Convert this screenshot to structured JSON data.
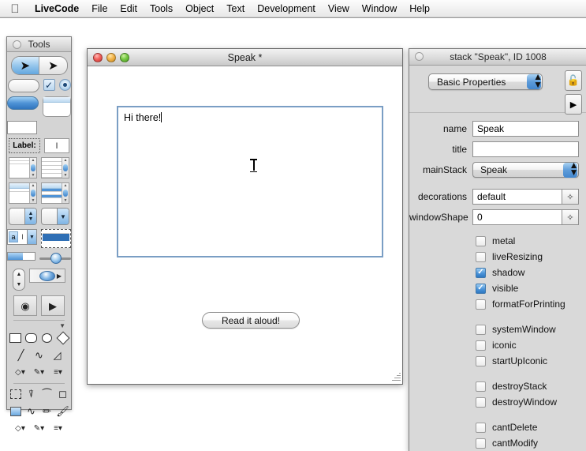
{
  "menubar": {
    "apple_icon": "apple-logo",
    "items": [
      {
        "label": "LiveCode",
        "bold": true
      },
      {
        "label": "File"
      },
      {
        "label": "Edit"
      },
      {
        "label": "Tools"
      },
      {
        "label": "Object"
      },
      {
        "label": "Text"
      },
      {
        "label": "Development"
      },
      {
        "label": "View"
      },
      {
        "label": "Window"
      },
      {
        "label": "Help"
      }
    ]
  },
  "tools_palette": {
    "title": "Tools",
    "selected_tool": "browse-tool",
    "tools": [
      "browse-tool",
      "pointer-tool",
      "button-tool",
      "checkbox-tool",
      "radiobutton-tool",
      "default-button-tool",
      "tabbed-button-tool",
      "rectangle-button-tool",
      "opaque-button-tool",
      "label-field-tool",
      "text-field-tool",
      "scrolling-field-tool",
      "table-field-tool",
      "list-field-tool",
      "scrolling-list-tool",
      "stepper-tool",
      "option-menu-tool",
      "combobox-tool",
      "datagrid-tool",
      "progressbar-tool",
      "slider-tool",
      "spinner-tool",
      "player-tool",
      "graphic-tool",
      "video-player-tool"
    ],
    "vector_tools": [
      "rectangle-tool",
      "rounded-rectangle-tool",
      "oval-tool",
      "polygon-tool",
      "line-tool",
      "curve-tool",
      "freehand-polygon-tool"
    ],
    "vector_options": [
      "fill-color-tool",
      "pen-color-tool",
      "line-size-tool"
    ],
    "paint_tools": [
      "select-tool",
      "bucket-tool",
      "spray-tool",
      "eraser-tool",
      "rectangle-paint-tool",
      "curve-paint-tool",
      "pencil-tool",
      "brush-tool"
    ],
    "paint_options": [
      "paint-fill-tool",
      "paint-pen-tool",
      "paint-size-tool"
    ]
  },
  "stack_window": {
    "title": "Speak *",
    "traffic_lights": [
      "close-button",
      "minimize-button",
      "zoom-button"
    ],
    "field": {
      "name": "speak-text-field",
      "value": "Hi there!",
      "placeholder": ""
    },
    "button": {
      "label": "Read it aloud!"
    },
    "resize_grip": "resize-grip"
  },
  "inspector": {
    "title": "stack \"Speak\", ID 1008",
    "selected_pane": "Basic Properties",
    "lock_icon": "unlocked-padlock-icon",
    "play_icon": "play-triangle-icon",
    "fields": [
      {
        "label": "name",
        "value": "Speak",
        "type": "text"
      },
      {
        "label": "title",
        "value": "",
        "type": "text"
      },
      {
        "label": "mainStack",
        "value": "Speak",
        "type": "popup"
      },
      {
        "label": "decorations",
        "value": "default",
        "type": "text-wand"
      },
      {
        "label": "windowShape",
        "value": "0",
        "type": "text-wand"
      }
    ],
    "checkbox_groups": [
      [
        {
          "label": "metal",
          "checked": false
        },
        {
          "label": "liveResizing",
          "checked": false
        },
        {
          "label": "shadow",
          "checked": true
        },
        {
          "label": "visible",
          "checked": true
        },
        {
          "label": "formatForPrinting",
          "checked": false
        }
      ],
      [
        {
          "label": "systemWindow",
          "checked": false
        },
        {
          "label": "iconic",
          "checked": false
        },
        {
          "label": "startUpIconic",
          "checked": false
        }
      ],
      [
        {
          "label": "destroyStack",
          "checked": false
        },
        {
          "label": "destroyWindow",
          "checked": false
        }
      ],
      [
        {
          "label": "cantDelete",
          "checked": false
        },
        {
          "label": "cantModify",
          "checked": false
        }
      ]
    ],
    "check_mark": "✓"
  },
  "colors": {
    "accent_blue": "#4a93d8",
    "palette_gray": "#d9d9d9",
    "field_border": "#7a9ec4",
    "desktop": "#ffffff"
  },
  "cursor": {
    "type": "ibeam-cursor"
  }
}
